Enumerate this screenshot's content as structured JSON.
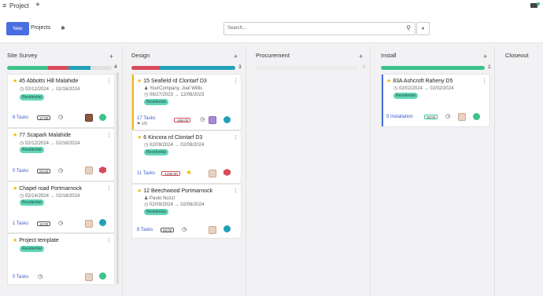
{
  "app": {
    "title": "Project",
    "menu_icon": "hamburger-icon",
    "add_icon": "plus-icon",
    "chat_icon": "chat-icon"
  },
  "toolbar": {
    "new_label": "New",
    "projects_label": "Projects",
    "settings_icon": "gear-icon",
    "search_placeholder": "Search...",
    "search_icon": "search-icon",
    "dropdown_icon": "chevron-down-icon"
  },
  "colors": {
    "accent": "#4a6ee0",
    "green": "#3cc38a",
    "teal": "#22a0b8",
    "red": "#d94a5a",
    "yellow": "#f5b800",
    "badge": "#63d6b9"
  },
  "columns": [
    {
      "name": "Site Survey",
      "count": "4",
      "progress": [
        0.5,
        0.2,
        0.2
      ]
    },
    {
      "name": "Design",
      "count": "3",
      "progress": [
        0.33,
        0.67
      ]
    },
    {
      "name": "Procurement",
      "count": "0"
    },
    {
      "name": "Install",
      "count": "1",
      "progress": [
        1.0
      ]
    },
    {
      "name": "Closeout"
    }
  ],
  "cards": {
    "abbotts": {
      "title": "45 Abbotts Hill Malahide",
      "dates": "02/12/2024 → 02/16/2024",
      "tag": "Residential",
      "tasks": "8 Tasks",
      "pill": "17:00"
    },
    "scapark": {
      "title": "77 Scapark Malahide",
      "dates": "02/12/2024 → 02/16/2024",
      "tag": "Residential",
      "tasks": "0 Tasks",
      "pill": "00:00"
    },
    "chapel": {
      "title": "Chapel road Portmarnock",
      "dates": "02/14/2024 → 02/16/2024",
      "tag": "Residential",
      "tasks": "1 Tasks",
      "pill": "12:00"
    },
    "template": {
      "title": "Project template",
      "tag": "Residential",
      "tasks": "0 Tasks"
    },
    "seafield": {
      "title": "15 Seafield rd Clontarf D3",
      "company": "YourCompany, Joel Willis",
      "dates": "09/27/2023 → 12/08/2023",
      "tag": "Residential",
      "tasks": "17 Tasks",
      "sub": "1/3",
      "pill": "-296:00"
    },
    "kincora": {
      "title": "6 Kincora rd Clontarf D3",
      "dates": "02/09/2024 → 02/09/2024",
      "tag": "Residential",
      "tasks": "11 Tasks",
      "pill": "-1335:00"
    },
    "beechwood": {
      "title": "12 Beechwood Portmarnock",
      "person": "Paolo Nozzi",
      "dates": "02/09/2024 → 02/09/2024",
      "tag": "Residential",
      "tasks": "8 Tasks",
      "pill": "00:00"
    },
    "ashcroft": {
      "title": "83A Ashcroft Raheny D5",
      "dates": "02/02/2024 → 02/02/2024",
      "tag": "Residential",
      "tasks": "5 Installation",
      "pill": "00:00"
    }
  }
}
